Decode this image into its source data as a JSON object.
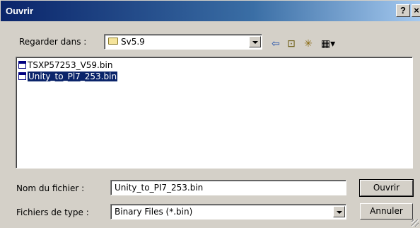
{
  "window": {
    "title": "Ouvrir",
    "help_label": "?",
    "close_label": "×"
  },
  "lookin": {
    "label": "Regarder dans :",
    "value": "Sv5.9"
  },
  "toolbar": {
    "back_glyph": "⇦",
    "up_glyph": "⊡",
    "newfolder_glyph": "✳",
    "view_glyph": "▦▾"
  },
  "files": [
    {
      "name": "TSXP57253_V59.bin",
      "selected": false
    },
    {
      "name": "Unity_to_Pl7_253.bin",
      "selected": true
    }
  ],
  "filename": {
    "label": "Nom du fichier :",
    "value": "Unity_to_PI7_253.bin"
  },
  "filetype": {
    "label": "Fichiers de type :",
    "value": "Binary Files (*.bin)"
  },
  "buttons": {
    "open": "Ouvrir",
    "cancel": "Annuler"
  },
  "colors": {
    "titlebar_start": "#0a246a",
    "titlebar_end": "#a6caf0",
    "face": "#d4d0c8",
    "selection": "#0a246a"
  }
}
